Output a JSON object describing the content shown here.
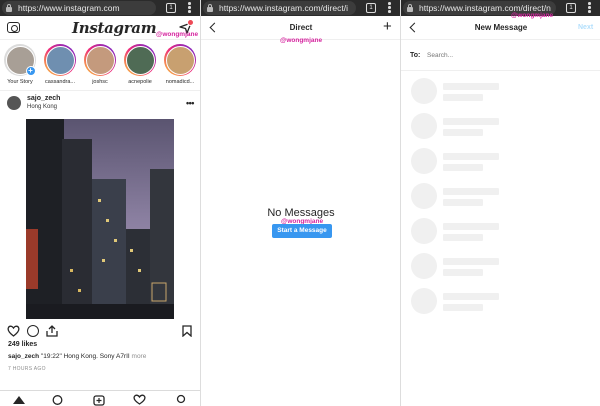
{
  "browser": {
    "tab_count": "1",
    "screen1_url": "https://www.instagram.com",
    "screen2_url": "https://www.instagram.com/direct/i",
    "screen3_url": "https://www.instagram.com/direct/n"
  },
  "watermark": "@wongmjane",
  "feed": {
    "logo": "Instagram",
    "stories": [
      {
        "name": "Your Story",
        "has_plus": true
      },
      {
        "name": "cassandra..."
      },
      {
        "name": "joshsc"
      },
      {
        "name": "acnepolie"
      },
      {
        "name": "nomadicd..."
      }
    ],
    "post": {
      "username": "sajo_zech",
      "location": "Hong Kong",
      "likes": "249 likes",
      "caption_user": "sajo_zech",
      "caption_text": "\"19:22\" Hong Kong. Sony A7rII",
      "more": "more",
      "time_ago": "7 HOURS AGO"
    }
  },
  "direct": {
    "title": "Direct",
    "empty_text": "No Messages",
    "start_button": "Start a Message"
  },
  "new_message": {
    "title": "New Message",
    "next": "Next",
    "to_label": "To:",
    "search_placeholder": "Search..."
  },
  "colors": {
    "accent_blue": "#3897f0",
    "notification_red": "#ed4956",
    "watermark_pink": "#d6249f"
  },
  "icons": [
    "camera-icon",
    "direct-send-icon",
    "heart-icon",
    "comment-icon",
    "share-icon",
    "bookmark-icon",
    "home-icon",
    "search-icon",
    "add-post-icon",
    "activity-icon",
    "profile-icon",
    "back-arrow-icon",
    "plus-icon"
  ]
}
